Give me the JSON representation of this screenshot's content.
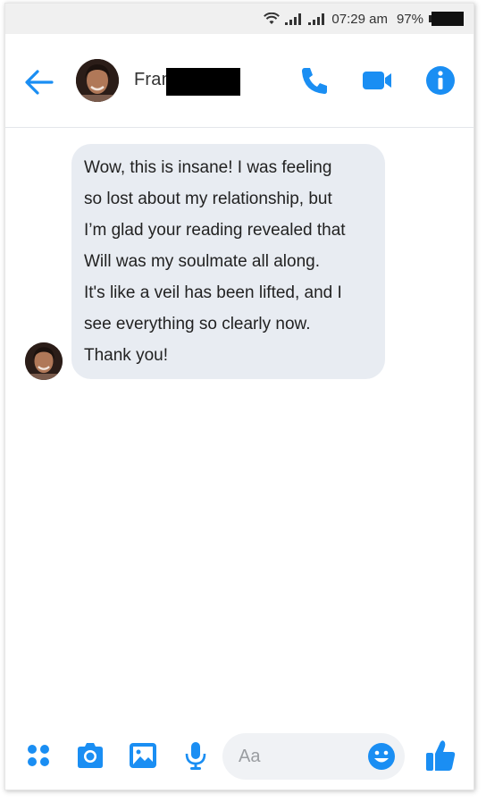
{
  "status_bar": {
    "time": "07:29 am",
    "battery": "97%",
    "icons": [
      "wifi-icon",
      "signal-icon",
      "signal-icon",
      "battery-icon"
    ]
  },
  "header": {
    "contact_name_visible": "Fran",
    "icons": [
      "back-arrow-icon",
      "phone-icon",
      "video-camera-icon",
      "info-icon"
    ],
    "accent_color": "#1a8ef3"
  },
  "conversation": {
    "messages": [
      {
        "sender": "contact",
        "lines": [
          "Wow, this is insane! I was feeling",
          "so lost about my relationship, but",
          "I’m glad your reading revealed that",
          "Will was my soulmate all along.",
          "It's like a veil has been lifted, and I",
          "see everything so clearly now.",
          "Thank you!"
        ]
      }
    ]
  },
  "composer": {
    "placeholder": "Aa",
    "icons": [
      "apps-grid-icon",
      "camera-icon",
      "image-icon",
      "microphone-icon",
      "emoji-icon",
      "thumbs-up-icon"
    ]
  }
}
